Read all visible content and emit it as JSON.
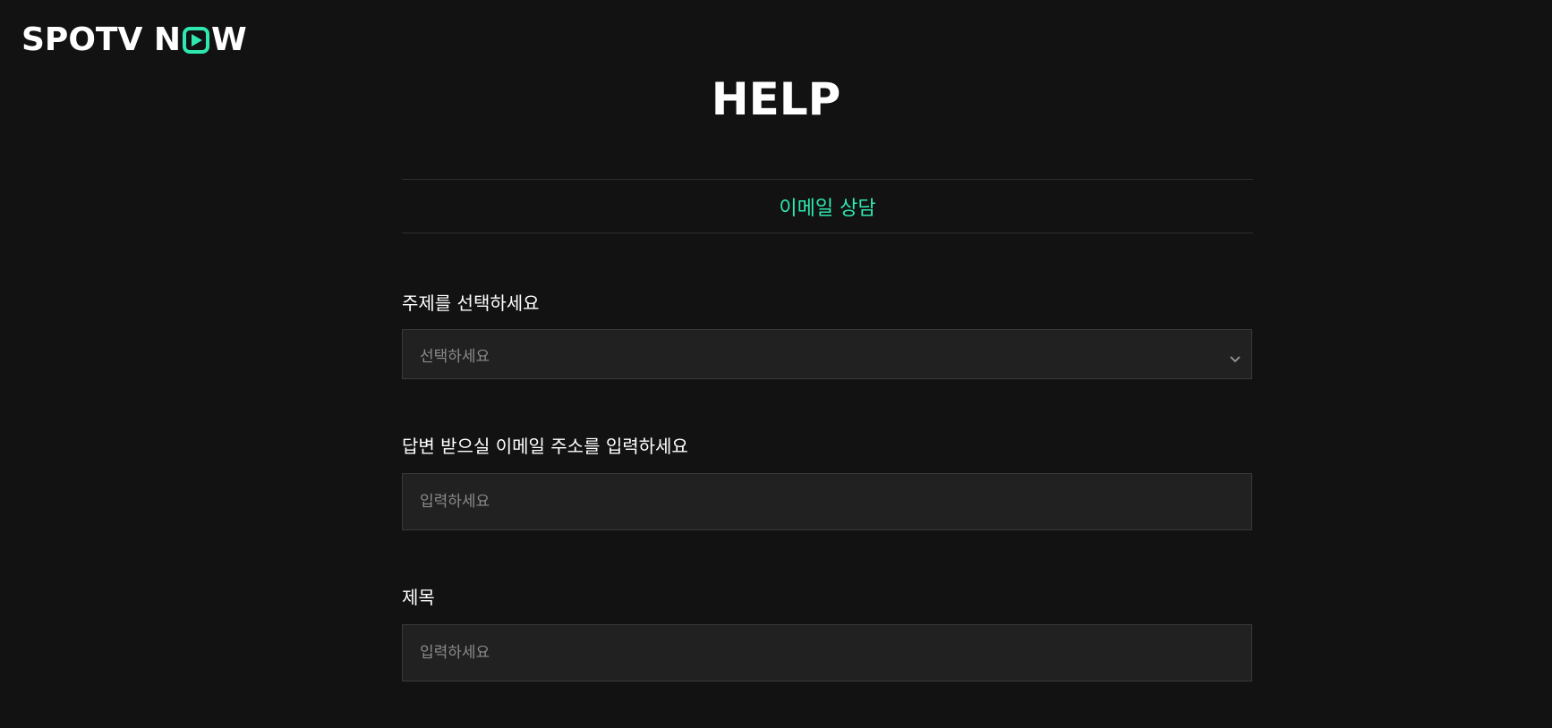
{
  "brand": {
    "logo_part1": "SPOTV N",
    "logo_part2": "W",
    "accent_color": "#2ee8b0"
  },
  "page": {
    "title": "HELP"
  },
  "tabs": [
    {
      "label": "이메일 상담",
      "active": true
    }
  ],
  "form": {
    "topic": {
      "label": "주제를 선택하세요",
      "selected_value": "선택하세요"
    },
    "email": {
      "label": "답변 받으실 이메일 주소를 입력하세요",
      "placeholder": "입력하세요"
    },
    "subject": {
      "label": "제목",
      "placeholder": "입력하세요"
    }
  }
}
